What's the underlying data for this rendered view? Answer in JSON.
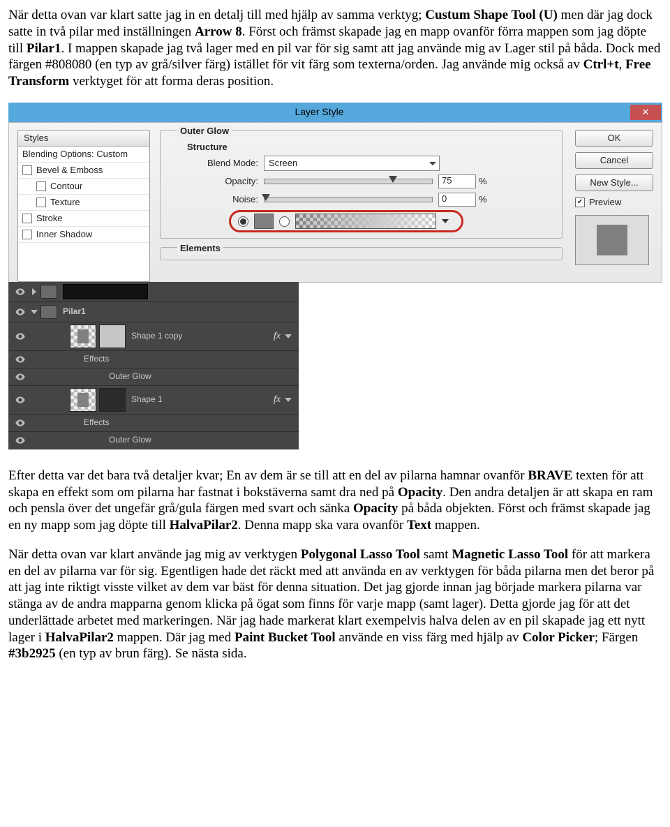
{
  "para1_parts": [
    {
      "t": "När detta ovan var klart satte jag in en detalj till med hjälp av samma verktyg; "
    },
    {
      "t": "Custum Shape Tool (U)",
      "b": true
    },
    {
      "t": " men där jag dock satte in två pilar med inställningen "
    },
    {
      "t": "Arrow 8",
      "b": true
    },
    {
      "t": ". Först och främst skapade jag en mapp ovanför förra mappen som jag döpte till "
    },
    {
      "t": "Pilar1",
      "b": true
    },
    {
      "t": ". I mappen skapade jag två lager med en pil var för sig samt att jag använde mig av Lager stil på båda. Dock med färgen #808080 (en typ av grå/silver färg) istället för vit färg som texterna/orden. Jag använde mig också av "
    },
    {
      "t": "Ctrl+t",
      "b": true
    },
    {
      "t": ", "
    },
    {
      "t": "Free Transform",
      "b": true
    },
    {
      "t": " verktyget för att forma deras position."
    }
  ],
  "layerstyle": {
    "title": "Layer Style",
    "close": "✕",
    "left": {
      "header": "Styles",
      "blending": "Blending Options: Custom",
      "items": [
        "Bevel & Emboss",
        "Contour",
        "Texture",
        "Stroke",
        "Inner Shadow"
      ]
    },
    "center": {
      "outer_glow": "Outer Glow",
      "structure": "Structure",
      "blend_mode_label": "Blend Mode:",
      "blend_mode_value": "Screen",
      "opacity_label": "Opacity:",
      "opacity_value": "75",
      "noise_label": "Noise:",
      "noise_value": "0",
      "pct": "%",
      "elements": "Elements"
    },
    "right": {
      "ok": "OK",
      "cancel": "Cancel",
      "new_style": "New Style...",
      "preview": "Preview"
    }
  },
  "layers": {
    "pilar1": "Pilar1",
    "shape1copy": "Shape 1 copy",
    "shape1": "Shape 1",
    "effects": "Effects",
    "outer_glow": "Outer Glow",
    "fx": "fx"
  },
  "para2_parts": [
    {
      "t": "Efter detta var det bara två detaljer kvar; En av dem är se till att en del av pilarna hamnar ovanför "
    },
    {
      "t": "BRAVE",
      "b": true
    },
    {
      "t": " texten för att skapa en effekt som om pilarna har fastnat i bokstäverna samt dra ned på "
    },
    {
      "t": "Opacity",
      "b": true
    },
    {
      "t": ". Den andra detaljen är att skapa en ram och pensla över det ungefär grå/gula färgen med svart och sänka "
    },
    {
      "t": "Opacity",
      "b": true
    },
    {
      "t": " på båda objekten. Först och främst skapade jag en ny mapp som jag döpte till "
    },
    {
      "t": "HalvaPilar2",
      "b": true
    },
    {
      "t": ". Denna mapp ska vara ovanför "
    },
    {
      "t": "Text",
      "b": true
    },
    {
      "t": " mappen."
    }
  ],
  "para3_parts": [
    {
      "t": "När detta ovan var klart använde jag mig av verktygen "
    },
    {
      "t": "Polygonal Lasso Tool",
      "b": true
    },
    {
      "t": " samt "
    },
    {
      "t": "Magnetic Lasso Tool",
      "b": true
    },
    {
      "t": " för att markera en del av pilarna var för sig. Egentligen hade det räckt med att använda en av verktygen för båda pilarna men det beror på att jag inte riktigt visste vilket av dem var bäst för denna situation. Det jag gjorde innan jag började markera pilarna var stänga av de andra mapparna genom klicka på ögat som finns för varje mapp (samt lager). Detta gjorde jag för att det underlättade arbetet med markeringen. När jag hade markerat klart exempelvis halva delen av en pil skapade jag ett nytt lager i "
    },
    {
      "t": "HalvaPilar2",
      "b": true
    },
    {
      "t": " mappen. Där jag med "
    },
    {
      "t": "Paint Bucket Tool",
      "b": true
    },
    {
      "t": " använde en viss färg med hjälp av "
    },
    {
      "t": "Color Picker",
      "b": true
    },
    {
      "t": "; Färgen "
    },
    {
      "t": "#3b2925",
      "b": true
    },
    {
      "t": " (en typ av brun färg). Se nästa sida."
    }
  ]
}
